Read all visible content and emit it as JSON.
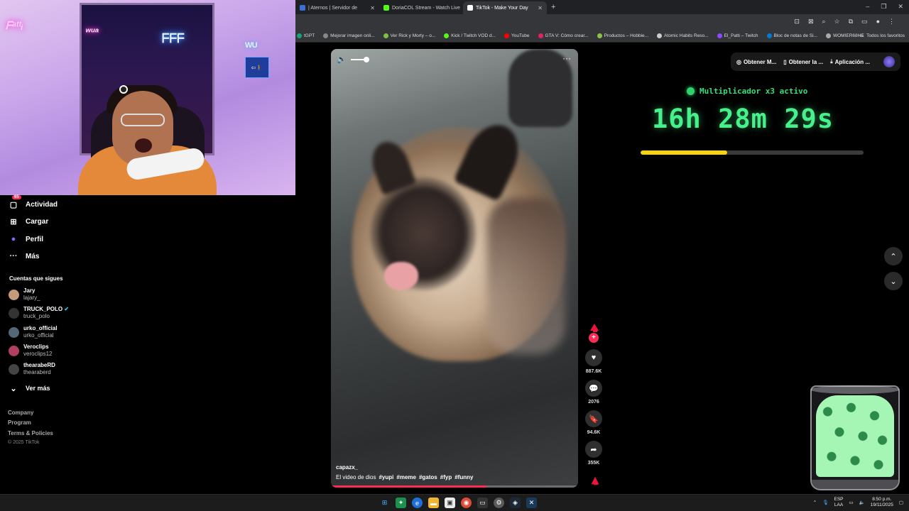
{
  "browser": {
    "tabs": [
      {
        "label": "| Aternos | Servidor de",
        "active": false,
        "favicon_color": "#3b6fd6"
      },
      {
        "label": "DoriaCOL Stream - Watch Live",
        "active": false,
        "favicon_color": "#53fc18"
      },
      {
        "label": "TikTok - Make Your Day",
        "active": true,
        "favicon_color": "#ffffff"
      }
    ],
    "new_tab": "+",
    "window_controls": [
      "–",
      "❐",
      "✕"
    ],
    "bookmarks": [
      {
        "label": "tGPT",
        "color": "#10a37f"
      },
      {
        "label": "Mejorar imagen onli...",
        "color": "#888888"
      },
      {
        "label": "Ver Rick y Morty – o...",
        "color": "#7cc242"
      },
      {
        "label": "Kick / Twitch VOD d...",
        "color": "#53fc18"
      },
      {
        "label": "YouTube",
        "color": "#ff0000"
      },
      {
        "label": "GTA V: Cómo crear...",
        "color": "#e0245e"
      },
      {
        "label": "Productos – Hobbie...",
        "color": "#8bc34a"
      },
      {
        "label": "Atomic Habits Reso...",
        "color": "#cccccc"
      },
      {
        "label": "El_Patti – Twitch",
        "color": "#9146ff"
      },
      {
        "label": "Bloc de notas de Si...",
        "color": "#0078d4"
      },
      {
        "label": "WOMIER68HE",
        "color": "#aaaaaa"
      }
    ],
    "all_bookmarks": "Todos los favoritos"
  },
  "sidebar": {
    "nav": [
      {
        "label": "Actividad",
        "icon": "inbox-icon",
        "glyph": "▢",
        "badge": "65"
      },
      {
        "label": "Cargar",
        "icon": "upload-icon",
        "glyph": "⊞"
      },
      {
        "label": "Perfil",
        "icon": "profile-icon",
        "glyph": "●"
      },
      {
        "label": "Más",
        "icon": "more-icon",
        "glyph": "···"
      }
    ],
    "following_title": "Cuentas que sigues",
    "following": [
      {
        "name": "Jary",
        "user": "lajary_",
        "avatar_color": "#c49a7a",
        "verified": false
      },
      {
        "name": "TRUCK_POLO",
        "user": "truck_polo",
        "avatar_color": "#333333",
        "verified": true
      },
      {
        "name": "urko_official",
        "user": "urko_official",
        "avatar_color": "#556677",
        "verified": false
      },
      {
        "name": "Veroclips",
        "user": "veroclips12",
        "avatar_color": "#b04060",
        "verified": false
      },
      {
        "name": "thearabeRD",
        "user": "thearaberd",
        "avatar_color": "#444444",
        "verified": false
      }
    ],
    "see_more": "Ver más",
    "footer_links": [
      "Company",
      "Program",
      "Terms & Policies"
    ],
    "copyright": "© 2025 TikTok"
  },
  "video": {
    "author": "capazx_",
    "caption": "El video de dios",
    "hashtags": [
      "#yupi",
      "#meme",
      "#gatos",
      "#fyp",
      "#funny"
    ],
    "progress": 0.63,
    "more": "···"
  },
  "actions": [
    {
      "name": "like",
      "icon": "heart-icon",
      "glyph": "♥",
      "count": "887.6K"
    },
    {
      "name": "comment",
      "icon": "comment-icon",
      "glyph": "💬",
      "count": "2076"
    },
    {
      "name": "save",
      "icon": "bookmark-icon",
      "glyph": "🔖",
      "count": "94.6K"
    },
    {
      "name": "share",
      "icon": "share-icon",
      "glyph": "➦",
      "count": "355K"
    }
  ],
  "topbar": {
    "items": [
      {
        "label": "Obtener M...",
        "icon": "coin-icon",
        "glyph": "◎"
      },
      {
        "label": "Obtener la ...",
        "icon": "phone-icon",
        "glyph": "▯"
      },
      {
        "label": "Aplicación ...",
        "icon": "download-icon",
        "glyph": "⤓"
      }
    ]
  },
  "overlay": {
    "multiplier": "Multiplicador x3 activo",
    "timer": "16h 28m 29s",
    "timer_progress": 0.39
  },
  "nav_arrows": {
    "up": "⌃",
    "down": "⌄"
  },
  "taskbar": {
    "lang_top": "ESP",
    "lang_bottom": "LAA",
    "time": "8:50 p.m.",
    "date": "19/11/2025"
  },
  "colors": {
    "accent": "#fe2c55",
    "timer_green": "#46f08a",
    "timer_bar": "#f2d21b"
  }
}
